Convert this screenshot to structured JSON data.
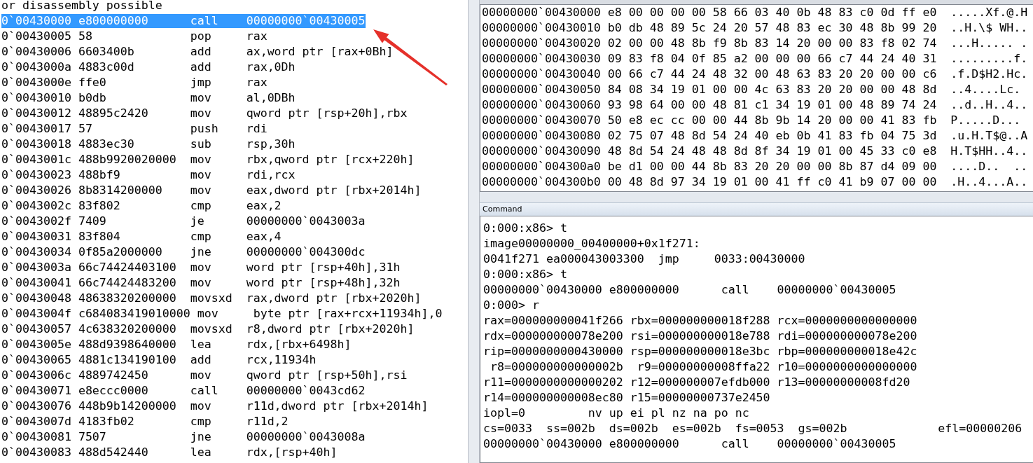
{
  "disassembly": {
    "header": "or disassembly possible",
    "rows": [
      {
        "address": "0`00430000",
        "bytes": "e800000000",
        "mnemonic": "call",
        "operands": "00000000`00430005",
        "selected": true
      },
      {
        "address": "0`00430005",
        "bytes": "58",
        "mnemonic": "pop",
        "operands": "rax",
        "selected": false
      },
      {
        "address": "0`00430006",
        "bytes": "6603400b",
        "mnemonic": "add",
        "operands": "ax,word ptr [rax+0Bh]",
        "selected": false
      },
      {
        "address": "0`0043000a",
        "bytes": "4883c00d",
        "mnemonic": "add",
        "operands": "rax,0Dh",
        "selected": false
      },
      {
        "address": "0`0043000e",
        "bytes": "ffe0",
        "mnemonic": "jmp",
        "operands": "rax",
        "selected": false
      },
      {
        "address": "0`00430010",
        "bytes": "b0db",
        "mnemonic": "mov",
        "operands": "al,0DBh",
        "selected": false
      },
      {
        "address": "0`00430012",
        "bytes": "48895c2420",
        "mnemonic": "mov",
        "operands": "qword ptr [rsp+20h],rbx",
        "selected": false
      },
      {
        "address": "0`00430017",
        "bytes": "57",
        "mnemonic": "push",
        "operands": "rdi",
        "selected": false
      },
      {
        "address": "0`00430018",
        "bytes": "4883ec30",
        "mnemonic": "sub",
        "operands": "rsp,30h",
        "selected": false
      },
      {
        "address": "0`0043001c",
        "bytes": "488b9920020000",
        "mnemonic": "mov",
        "operands": "rbx,qword ptr [rcx+220h]",
        "selected": false
      },
      {
        "address": "0`00430023",
        "bytes": "488bf9",
        "mnemonic": "mov",
        "operands": "rdi,rcx",
        "selected": false
      },
      {
        "address": "0`00430026",
        "bytes": "8b8314200000",
        "mnemonic": "mov",
        "operands": "eax,dword ptr [rbx+2014h]",
        "selected": false
      },
      {
        "address": "0`0043002c",
        "bytes": "83f802",
        "mnemonic": "cmp",
        "operands": "eax,2",
        "selected": false
      },
      {
        "address": "0`0043002f",
        "bytes": "7409",
        "mnemonic": "je",
        "operands": "00000000`0043003a",
        "selected": false
      },
      {
        "address": "0`00430031",
        "bytes": "83f804",
        "mnemonic": "cmp",
        "operands": "eax,4",
        "selected": false
      },
      {
        "address": "0`00430034",
        "bytes": "0f85a2000000",
        "mnemonic": "jne",
        "operands": "00000000`004300dc",
        "selected": false
      },
      {
        "address": "0`0043003a",
        "bytes": "66c74424403100",
        "mnemonic": "mov",
        "operands": "word ptr [rsp+40h],31h",
        "selected": false
      },
      {
        "address": "0`00430041",
        "bytes": "66c74424483200",
        "mnemonic": "mov",
        "operands": "word ptr [rsp+48h],32h",
        "selected": false
      },
      {
        "address": "0`00430048",
        "bytes": "48638320200000",
        "mnemonic": "movsxd",
        "operands": "rax,dword ptr [rbx+2020h]",
        "selected": false
      },
      {
        "address": "0`0043004f",
        "bytes": "c684083419010000",
        "mnemonic": "mov",
        "operands": "byte ptr [rax+rcx+11934h],0",
        "selected": false
      },
      {
        "address": "0`00430057",
        "bytes": "4c638320200000",
        "mnemonic": "movsxd",
        "operands": "r8,dword ptr [rbx+2020h]",
        "selected": false
      },
      {
        "address": "0`0043005e",
        "bytes": "488d9398640000",
        "mnemonic": "lea",
        "operands": "rdx,[rbx+6498h]",
        "selected": false
      },
      {
        "address": "0`00430065",
        "bytes": "4881c134190100",
        "mnemonic": "add",
        "operands": "rcx,11934h",
        "selected": false
      },
      {
        "address": "0`0043006c",
        "bytes": "4889742450",
        "mnemonic": "mov",
        "operands": "qword ptr [rsp+50h],rsi",
        "selected": false
      },
      {
        "address": "0`00430071",
        "bytes": "e8eccc0000",
        "mnemonic": "call",
        "operands": "00000000`0043cd62",
        "selected": false
      },
      {
        "address": "0`00430076",
        "bytes": "448b9b14200000",
        "mnemonic": "mov",
        "operands": "r11d,dword ptr [rbx+2014h]",
        "selected": false
      },
      {
        "address": "0`0043007d",
        "bytes": "4183fb02",
        "mnemonic": "cmp",
        "operands": "r11d,2",
        "selected": false
      },
      {
        "address": "0`00430081",
        "bytes": "7507",
        "mnemonic": "jne",
        "operands": "00000000`0043008a",
        "selected": false
      },
      {
        "address": "0`00430083",
        "bytes": "488d542440",
        "mnemonic": "lea",
        "operands": "rdx,[rsp+40h]",
        "selected": false
      }
    ]
  },
  "memory": {
    "rows": [
      {
        "address": "00000000`00430000",
        "bytes": "e8 00 00 00 00 58 66 03 40 0b 48 83 c0 0d ff e0",
        "ascii": ".....Xf.@.H"
      },
      {
        "address": "00000000`00430010",
        "bytes": "b0 db 48 89 5c 24 20 57 48 83 ec 30 48 8b 99 20",
        "ascii": "..H.\\$ WH.."
      },
      {
        "address": "00000000`00430020",
        "bytes": "02 00 00 48 8b f9 8b 83 14 20 00 00 83 f8 02 74",
        "ascii": "...H..... ."
      },
      {
        "address": "00000000`00430030",
        "bytes": "09 83 f8 04 0f 85 a2 00 00 00 66 c7 44 24 40 31",
        "ascii": ".........f."
      },
      {
        "address": "00000000`00430040",
        "bytes": "00 66 c7 44 24 48 32 00 48 63 83 20 20 00 00 c6",
        "ascii": ".f.D$H2.Hc."
      },
      {
        "address": "00000000`00430050",
        "bytes": "84 08 34 19 01 00 00 4c 63 83 20 20 00 00 48 8d",
        "ascii": "..4....Lc."
      },
      {
        "address": "00000000`00430060",
        "bytes": "93 98 64 00 00 48 81 c1 34 19 01 00 48 89 74 24",
        "ascii": "..d..H..4.."
      },
      {
        "address": "00000000`00430070",
        "bytes": "50 e8 ec cc 00 00 44 8b 9b 14 20 00 00 41 83 fb",
        "ascii": "P.....D..."
      },
      {
        "address": "00000000`00430080",
        "bytes": "02 75 07 48 8d 54 24 40 eb 0b 41 83 fb 04 75 3d",
        "ascii": ".u.H.T$@..A"
      },
      {
        "address": "00000000`00430090",
        "bytes": "48 8d 54 24 48 48 8d 8f 34 19 01 00 45 33 c0 e8",
        "ascii": "H.T$HH..4.."
      },
      {
        "address": "00000000`004300a0",
        "bytes": "be d1 00 00 44 8b 83 20 20 00 00 8b 87 d4 09 00",
        "ascii": "....D..  .."
      },
      {
        "address": "00000000`004300b0",
        "bytes": "00 48 8d 97 34 19 01 00 41 ff c0 41 b9 07 00 00",
        "ascii": ".H..4...A.."
      }
    ]
  },
  "command": {
    "title": "Command",
    "lines": [
      "0:000:x86> t",
      "image00000000_00400000+0x1f271:",
      "0041f271 ea000043003300  jmp     0033:00430000",
      "0:000:x86> t",
      "00000000`00430000 e800000000      call    00000000`00430005",
      "0:000> r",
      "rax=000000000041f266 rbx=000000000018f288 rcx=0000000000000000",
      "rdx=000000000078e200 rsi=000000000018e788 rdi=000000000078e200",
      "rip=0000000000430000 rsp=000000000018e3bc rbp=000000000018e42c",
      " r8=000000000000002b  r9=00000000008ffa22 r10=0000000000000000",
      "r11=0000000000000202 r12=000000007efdb000 r13=00000000008fd20",
      "r14=000000000008ec80 r15=00000000737e2450",
      "iopl=0         nv up ei pl nz na po nc",
      "cs=0033  ss=002b  ds=002b  es=002b  fs=0053  gs=002b             efl=00000206",
      "00000000`00430000 e800000000      call    00000000`00430005"
    ]
  }
}
